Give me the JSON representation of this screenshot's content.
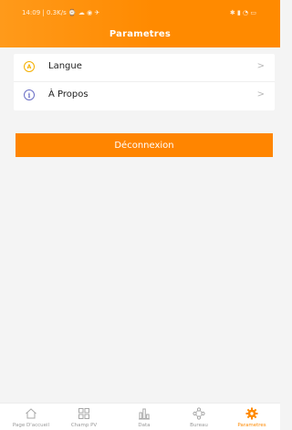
{
  "status_bar": {
    "left": "14:09 | 0.3K/s ⌚ ☁ ◉ ✈",
    "right": "✱ ▮ ◔ ▭"
  },
  "header": {
    "title": "Parametres"
  },
  "settings": {
    "items": [
      {
        "label": "Langue",
        "icon": "language-icon",
        "chevron": ">"
      },
      {
        "label": "À Propos",
        "icon": "info-icon",
        "chevron": ">"
      }
    ]
  },
  "logout": {
    "label": "Déconnexion"
  },
  "bottom_nav": {
    "active_color": "#ff8a00",
    "items": [
      {
        "label": "Page D'accueil",
        "icon": "home-icon"
      },
      {
        "label": "Champ PV",
        "icon": "grid-icon"
      },
      {
        "label": "Data",
        "icon": "bar-chart-icon"
      },
      {
        "label": "Bureau",
        "icon": "network-icon"
      },
      {
        "label": "Parametres",
        "icon": "gear-icon",
        "active": true
      }
    ]
  },
  "colors": {
    "accent": "#ff8a00",
    "background": "#f4f4f4"
  }
}
